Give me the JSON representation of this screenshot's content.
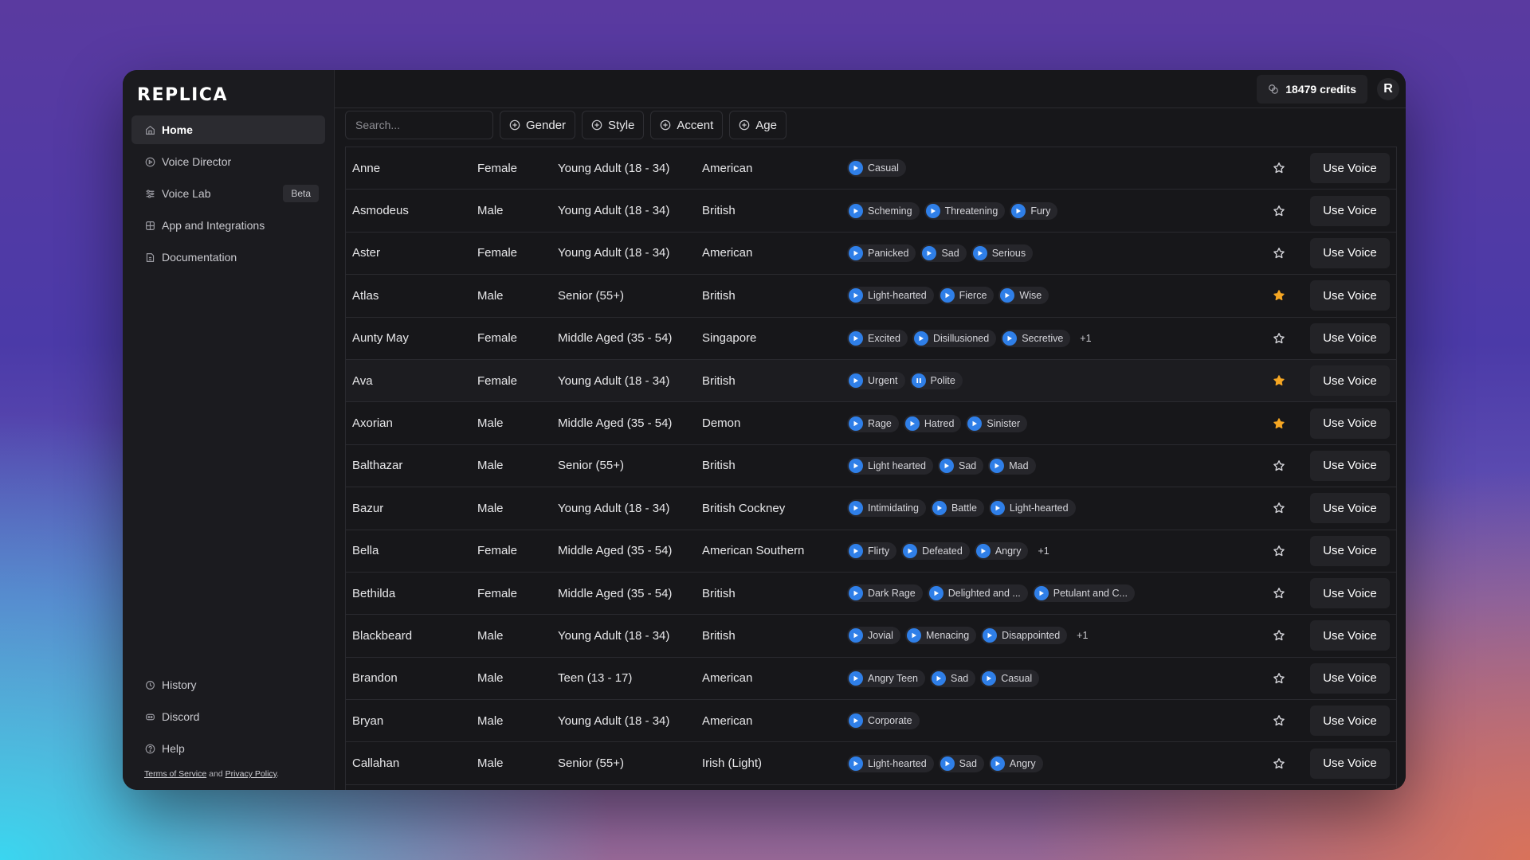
{
  "app": {
    "logo_text": "REPLICA",
    "credits": "18479 credits",
    "avatar_initial": "R"
  },
  "sidebar": {
    "items": [
      {
        "label": "Home",
        "icon": "home-icon",
        "active": true
      },
      {
        "label": "Voice Director",
        "icon": "play-circle-icon"
      },
      {
        "label": "Voice Lab",
        "icon": "sliders-icon",
        "badge": "Beta"
      },
      {
        "label": "App and Integrations",
        "icon": "grid-icon"
      },
      {
        "label": "Documentation",
        "icon": "document-icon"
      }
    ],
    "bottom_items": [
      {
        "label": "History",
        "icon": "history-icon"
      },
      {
        "label": "Discord",
        "icon": "discord-icon"
      },
      {
        "label": "Help",
        "icon": "help-icon"
      }
    ],
    "legal": {
      "terms": "Terms of Service",
      "and": "and",
      "privacy": "Privacy Policy",
      "period": "."
    }
  },
  "filters": {
    "search_placeholder": "Search...",
    "buttons": [
      "Gender",
      "Style",
      "Accent",
      "Age"
    ]
  },
  "voices": [
    {
      "name": "Anne",
      "gender": "Female",
      "age": "Young Adult (18 - 34)",
      "accent": "American",
      "styles": [
        "Casual"
      ],
      "more": "",
      "starred": false
    },
    {
      "name": "Asmodeus",
      "gender": "Male",
      "age": "Young Adult (18 - 34)",
      "accent": "British",
      "styles": [
        "Scheming",
        "Threatening",
        "Fury"
      ],
      "more": "",
      "starred": false
    },
    {
      "name": "Aster",
      "gender": "Female",
      "age": "Young Adult (18 - 34)",
      "accent": "American",
      "styles": [
        "Panicked",
        "Sad",
        "Serious"
      ],
      "more": "",
      "starred": false
    },
    {
      "name": "Atlas",
      "gender": "Male",
      "age": "Senior (55+)",
      "accent": "British",
      "styles": [
        "Light-hearted",
        "Fierce",
        "Wise"
      ],
      "more": "",
      "starred": true
    },
    {
      "name": "Aunty May",
      "gender": "Female",
      "age": "Middle Aged (35 - 54)",
      "accent": "Singapore",
      "styles": [
        "Excited",
        "Disillusioned",
        "Secretive"
      ],
      "more": "+1",
      "starred": false
    },
    {
      "name": "Ava",
      "gender": "Female",
      "age": "Young Adult (18 - 34)",
      "accent": "British",
      "styles": [
        "Urgent",
        "Polite"
      ],
      "playing": 1,
      "more": "",
      "starred": true
    },
    {
      "name": "Axorian",
      "gender": "Male",
      "age": "Middle Aged (35 - 54)",
      "accent": "Demon",
      "styles": [
        "Rage",
        "Hatred",
        "Sinister"
      ],
      "more": "",
      "starred": true
    },
    {
      "name": "Balthazar",
      "gender": "Male",
      "age": "Senior (55+)",
      "accent": "British",
      "styles": [
        "Light hearted",
        "Sad",
        "Mad"
      ],
      "more": "",
      "starred": false
    },
    {
      "name": "Bazur",
      "gender": "Male",
      "age": "Young Adult (18 - 34)",
      "accent": "British Cockney",
      "styles": [
        "Intimidating",
        "Battle",
        "Light-hearted"
      ],
      "more": "",
      "starred": false
    },
    {
      "name": "Bella",
      "gender": "Female",
      "age": "Middle Aged (35 - 54)",
      "accent": "American Southern",
      "styles": [
        "Flirty",
        "Defeated",
        "Angry"
      ],
      "more": "+1",
      "starred": false
    },
    {
      "name": "Bethilda",
      "gender": "Female",
      "age": "Middle Aged (35 - 54)",
      "accent": "British",
      "styles": [
        "Dark Rage",
        "Delighted and ...",
        "Petulant and C..."
      ],
      "more": "",
      "starred": false
    },
    {
      "name": "Blackbeard",
      "gender": "Male",
      "age": "Young Adult (18 - 34)",
      "accent": "British",
      "styles": [
        "Jovial",
        "Menacing",
        "Disappointed"
      ],
      "more": "+1",
      "starred": false
    },
    {
      "name": "Brandon",
      "gender": "Male",
      "age": "Teen (13 - 17)",
      "accent": "American",
      "styles": [
        "Angry Teen",
        "Sad",
        "Casual"
      ],
      "more": "",
      "starred": false
    },
    {
      "name": "Bryan",
      "gender": "Male",
      "age": "Young Adult (18 - 34)",
      "accent": "American",
      "styles": [
        "Corporate"
      ],
      "more": "",
      "starred": false
    },
    {
      "name": "Callahan",
      "gender": "Male",
      "age": "Senior (55+)",
      "accent": "Irish (Light)",
      "styles": [
        "Light-hearted",
        "Sad",
        "Angry"
      ],
      "more": "",
      "starred": false
    }
  ],
  "row_action_label": "Use Voice",
  "colors": {
    "accent_blue": "#2f7fe8",
    "star_gold": "#f5a623"
  }
}
